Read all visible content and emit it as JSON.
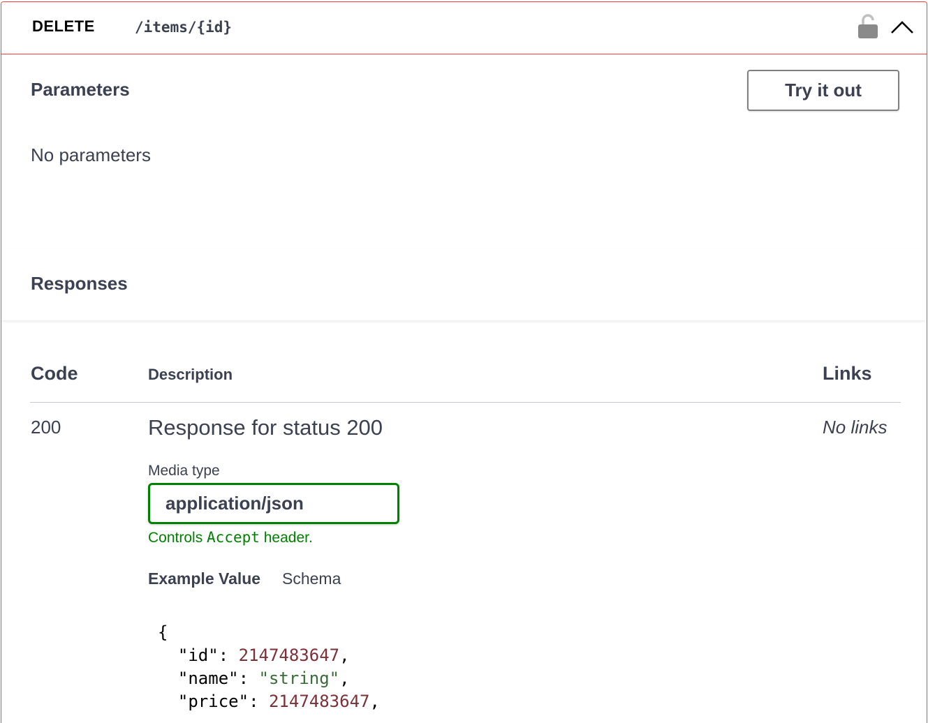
{
  "operation": {
    "method": "DELETE",
    "path": "/items/{id}"
  },
  "icons": {
    "lock": "unlocked-padlock-icon",
    "collapse": "chevron-up-icon"
  },
  "colors": {
    "delete_accent": "#f93e3e",
    "media_border": "#008000",
    "number": "#7d2f36",
    "string": "#3a6b3a"
  },
  "parameters": {
    "title": "Parameters",
    "try_button": "Try it out",
    "empty_text": "No parameters"
  },
  "responses": {
    "title": "Responses",
    "columns": {
      "code": "Code",
      "description": "Description",
      "links": "Links"
    },
    "rows": [
      {
        "code": "200",
        "description": "Response for status 200",
        "links": "No links",
        "media_type_label": "Media type",
        "media_type": "application/json",
        "controls_prefix": "Controls ",
        "controls_code": "Accept",
        "controls_suffix": " header.",
        "tabs": [
          "Example Value",
          "Schema"
        ],
        "example": {
          "open": "{",
          "lines": [
            {
              "key": "\"id\"",
              "sep": ": ",
              "value": "2147483647",
              "type": "num",
              "end": ","
            },
            {
              "key": "\"name\"",
              "sep": ": ",
              "value": "\"string\"",
              "type": "str",
              "end": ","
            },
            {
              "key": "\"price\"",
              "sep": ": ",
              "value": "2147483647",
              "type": "num",
              "end": ","
            }
          ]
        }
      }
    ]
  }
}
